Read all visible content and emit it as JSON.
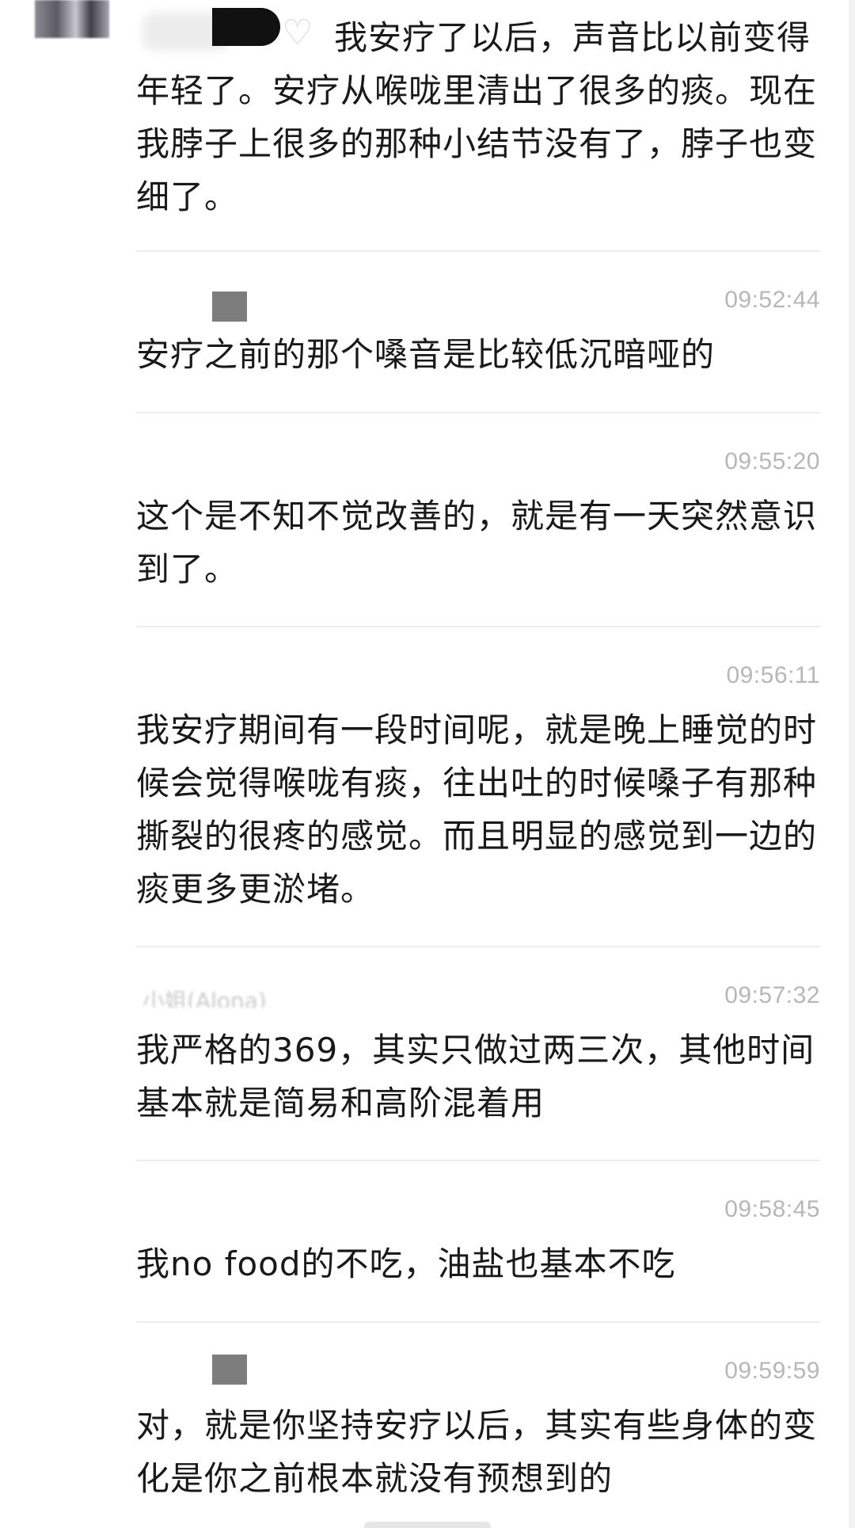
{
  "messages": [
    {
      "id": "m0",
      "text": "我安疗了以后，声音比以前变得年轻了。安疗从喉咙里清出了很多的痰。现在我脖子上很多的那种小结节没有了，脖子也变细了。"
    },
    {
      "id": "m1",
      "timestamp": "09:52:44",
      "text": "安疗之前的那个嗓音是比较低沉暗哑的"
    },
    {
      "id": "m2",
      "timestamp": "09:55:20",
      "text": "这个是不知不觉改善的，就是有一天突然意识到了。"
    },
    {
      "id": "m3",
      "timestamp": "09:56:11",
      "text": "我安疗期间有一段时间呢，就是晚上睡觉的时候会觉得喉咙有痰，往出吐的时候嗓子有那种撕裂的很疼的感觉。而且明显的感觉到一边的痰更多更淤堵。"
    },
    {
      "id": "m4",
      "timestamp": "09:57:32",
      "sender_partial": "小姐(Alona)",
      "text": "我严格的369，其实只做过两三次，其他时间基本就是简易和高阶混着用"
    },
    {
      "id": "m5",
      "timestamp": "09:58:45",
      "text": "我no  food的不吃，油盐也基本不吃"
    },
    {
      "id": "m6",
      "timestamp": "09:59:59",
      "text": "对，就是你坚持安疗以后，其实有些身体的变化是你之前根本就没有预想到的"
    }
  ],
  "icons": {
    "heart": "white-heart-icon"
  },
  "colors": {
    "timestamp": "#b7b7b7",
    "text": "#191919",
    "divider": "#ededed"
  }
}
